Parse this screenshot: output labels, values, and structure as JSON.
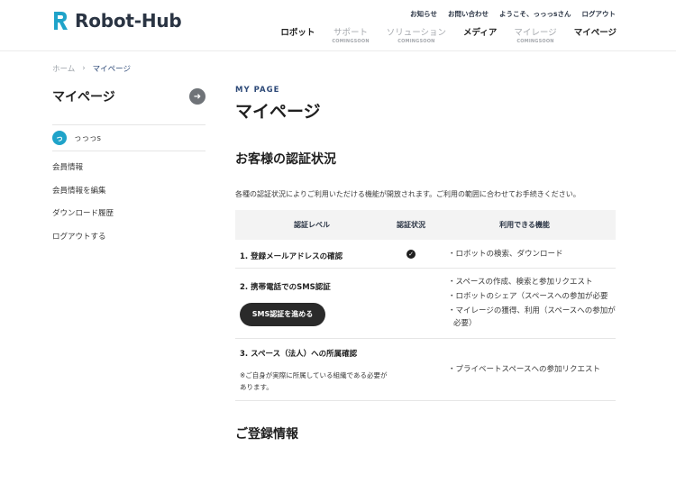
{
  "header": {
    "logo_text": "Robot-Hub",
    "util_links": [
      "お知らせ",
      "お問い合わせ",
      "ようこそ、っっっsさん",
      "ログアウト"
    ],
    "nav": [
      {
        "label": "ロボット",
        "sub": "",
        "dim": false
      },
      {
        "label": "サポート",
        "sub": "COMINGSOON",
        "dim": true
      },
      {
        "label": "ソリューション",
        "sub": "COMINGSOON",
        "dim": true
      },
      {
        "label": "メディア",
        "sub": "",
        "dim": false
      },
      {
        "label": "マイレージ",
        "sub": "COMINGSOON",
        "dim": true
      },
      {
        "label": "マイページ",
        "sub": "",
        "dim": false
      }
    ]
  },
  "breadcrumb": {
    "home": "ホーム",
    "separator": "›",
    "current": "マイページ"
  },
  "sidebar": {
    "title": "マイページ",
    "user_initial": "っ",
    "user_name": "っっっs",
    "menu": [
      "会員情報",
      "会員情報を編集",
      "ダウンロード履歴",
      "ログアウトする"
    ]
  },
  "main": {
    "eyebrow": "MY PAGE",
    "title": "マイページ",
    "section_title": "お客様の認証状況",
    "description": "各種の認証状況によりご利用いただける機能が開放されます。ご利用の範囲に合わせてお手続きください。",
    "table": {
      "headers": [
        "認証レベル",
        "認証状況",
        "利用できる機能"
      ],
      "rows": [
        {
          "level": "1. 登録メールアドレスの確認",
          "verified": true,
          "features": [
            "・ロボットの検索、ダウンロード"
          ]
        },
        {
          "level": "2. 携帯電話でのSMS認証",
          "button": "SMS認証を進める",
          "verified": false,
          "features": [
            "・スペースの作成、検索と参加リクエスト",
            "・ロボットのシェア（スペースへの参加が必要",
            "・マイレージの獲得、利用（スペースへの参加が必要）"
          ]
        },
        {
          "level": "3. スペース（法人）への所属確認",
          "note": "※ご自身が実際に所属している組織である必要があります。",
          "verified": false,
          "features": [
            "・プライベートスペースへの参加リクエスト"
          ]
        }
      ]
    },
    "section_title_2": "ご登録情報"
  },
  "colors": {
    "accent": "#1fa3c9",
    "navy": "#2e4a78",
    "button_dark": "#2a2a2a"
  }
}
